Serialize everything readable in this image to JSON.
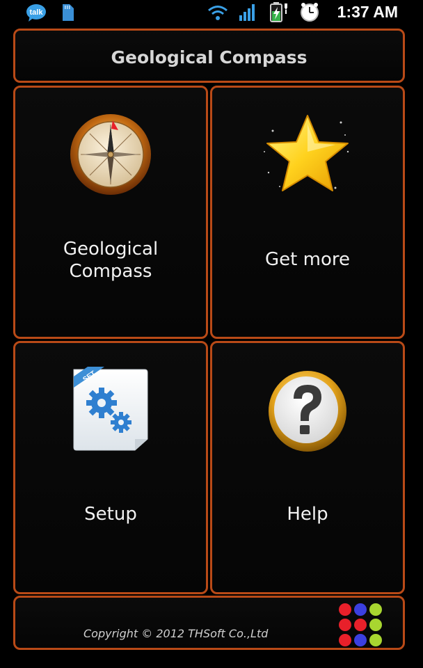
{
  "status_bar": {
    "talk_icon_label": "talk",
    "time": "1:37 AM"
  },
  "header": {
    "title": "Geological Compass"
  },
  "tiles": [
    {
      "label_line1": "Geological",
      "label_line2": "Compass",
      "icon": "compass-icon"
    },
    {
      "label": "Get more",
      "icon": "star-icon"
    },
    {
      "label": "Setup",
      "icon": "settings-document-icon",
      "badge": "SET"
    },
    {
      "label": "Help",
      "icon": "help-icon"
    }
  ],
  "footer": {
    "copyright": "Copyright © 2012 THSoft Co.,Ltd",
    "dot_colors": [
      "#e8202a",
      "#3b3fe0",
      "#a8d630",
      "#e8202a",
      "#e8202a",
      "#a8d630",
      "#e8202a",
      "#3b3fe0",
      "#a8d630"
    ]
  },
  "colors": {
    "panel_border": "#b94a17",
    "background": "#000000"
  }
}
